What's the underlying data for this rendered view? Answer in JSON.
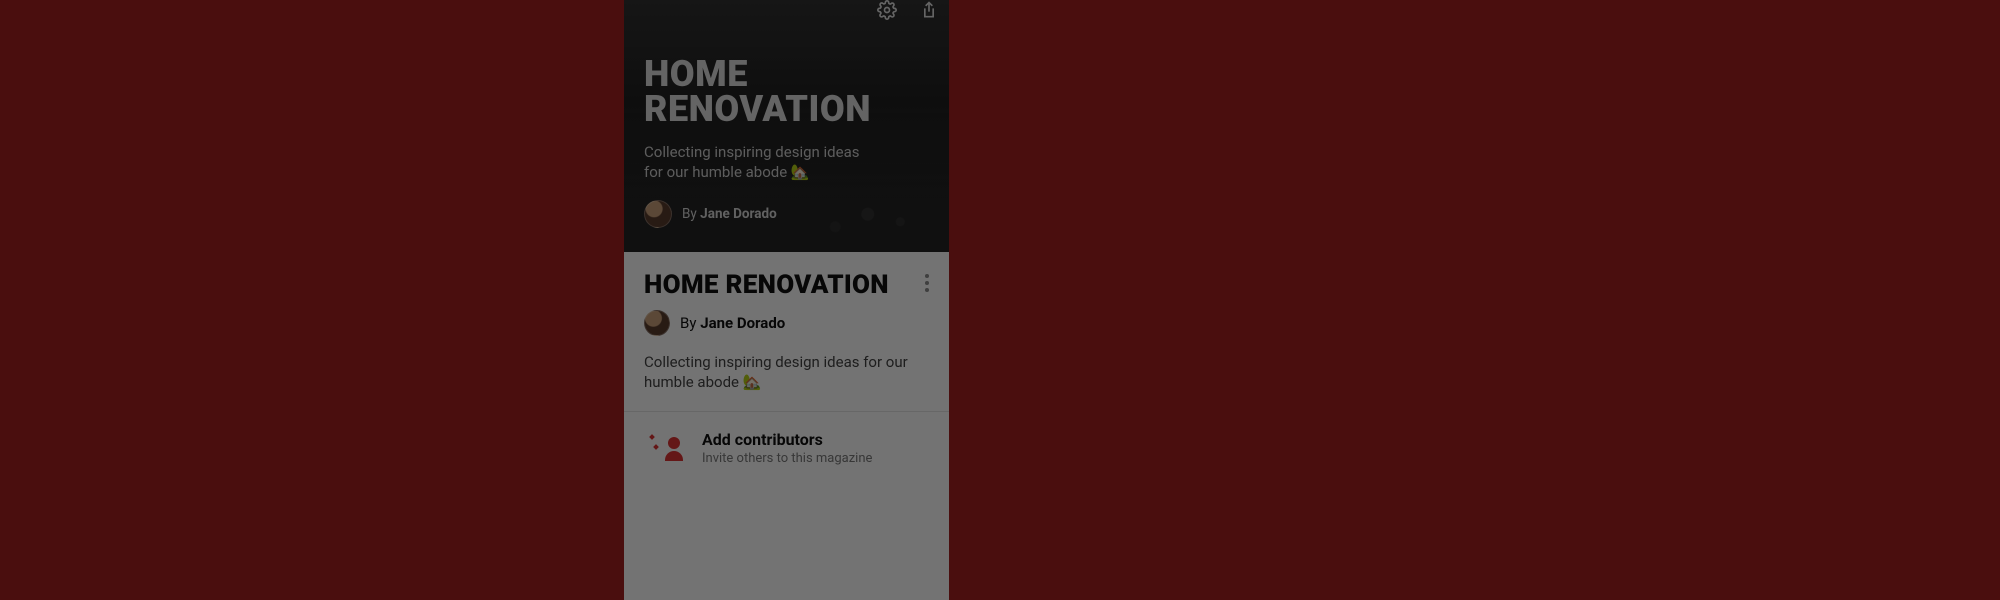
{
  "hero": {
    "title": "HOME RENOVATION",
    "description": "Collecting inspiring design ideas for our humble abode 🏡",
    "by_label": "By",
    "author_name": "Jane Dorado",
    "settings_icon": "gear-icon",
    "share_icon": "share-icon"
  },
  "panel": {
    "title": "HOME RENOVATION",
    "by_label": "By",
    "author_name": "Jane Dorado",
    "description": "Collecting inspiring design ideas for our humble abode 🏡",
    "more_icon": "more-vert-icon"
  },
  "contributors": {
    "icon": "add-person-icon",
    "title": "Add contributors",
    "subtitle": "Invite others to this magazine"
  },
  "colors": {
    "background": "#4a0e0e",
    "accent": "#d33"
  }
}
